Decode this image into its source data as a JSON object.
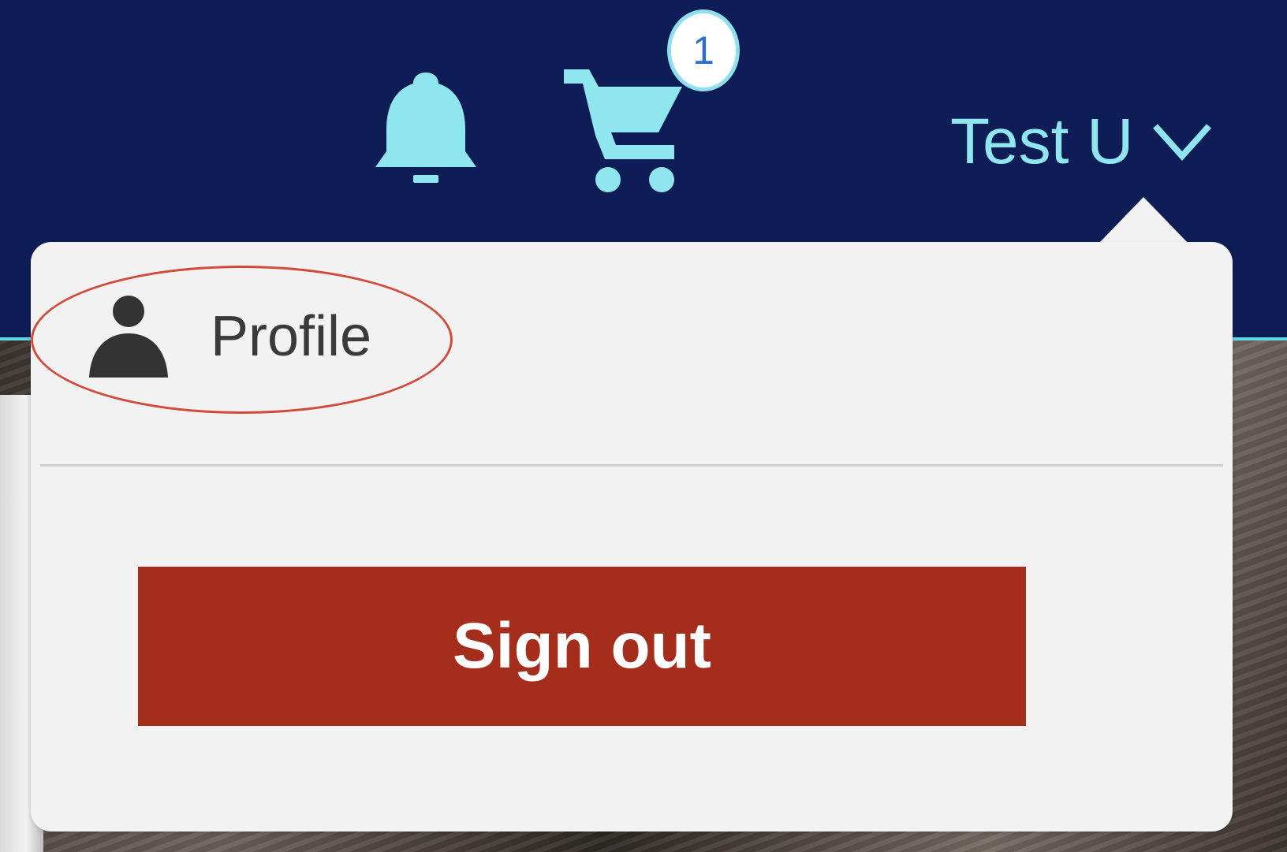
{
  "header": {
    "background_color": "#0f1d57",
    "accent_color": "#8fe6ef",
    "notifications_icon": "bell-icon",
    "cart_icon": "shopping-cart-icon",
    "cart_badge_count": "1",
    "user_name": "Test U",
    "user_menu_icon": "chevron-down-icon"
  },
  "user_dropdown": {
    "profile_label": "Profile",
    "profile_icon": "person-icon",
    "signout_label": "Sign out",
    "signout_color": "#a42d1c",
    "annotation_color": "#d24a3a"
  }
}
